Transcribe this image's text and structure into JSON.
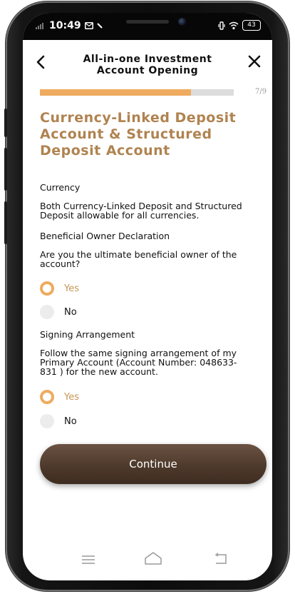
{
  "status": {
    "time": "10:49",
    "battery": "43"
  },
  "header": {
    "title": "All-in-one Investment Account Opening",
    "back_icon": "chevron-left-icon",
    "close_icon": "close-icon"
  },
  "progress": {
    "label": "7/9",
    "fraction": 0.78
  },
  "section": {
    "title": "Currency-Linked Deposit Account & Structured Deposit Account"
  },
  "currency": {
    "heading": "Currency",
    "text": "Both Currency-Linked Deposit and Structured Deposit allowable for all currencies."
  },
  "beneficial": {
    "heading": "Beneficial Owner Declaration",
    "question": "Are you the ultimate beneficial owner of the account?",
    "yes_label": "Yes",
    "no_label": "No",
    "selected": "Yes"
  },
  "signing": {
    "heading": "Signing Arrangement",
    "question": "Follow the same signing arrangement of my Primary Account (Account Number: 048633-831 ) for the new account.",
    "yes_label": "Yes",
    "no_label": "No",
    "selected": "Yes"
  },
  "continue_label": "Continue",
  "colors": {
    "accent": "#efab5f",
    "title": "#b08350",
    "button": "#4e3a2c"
  }
}
